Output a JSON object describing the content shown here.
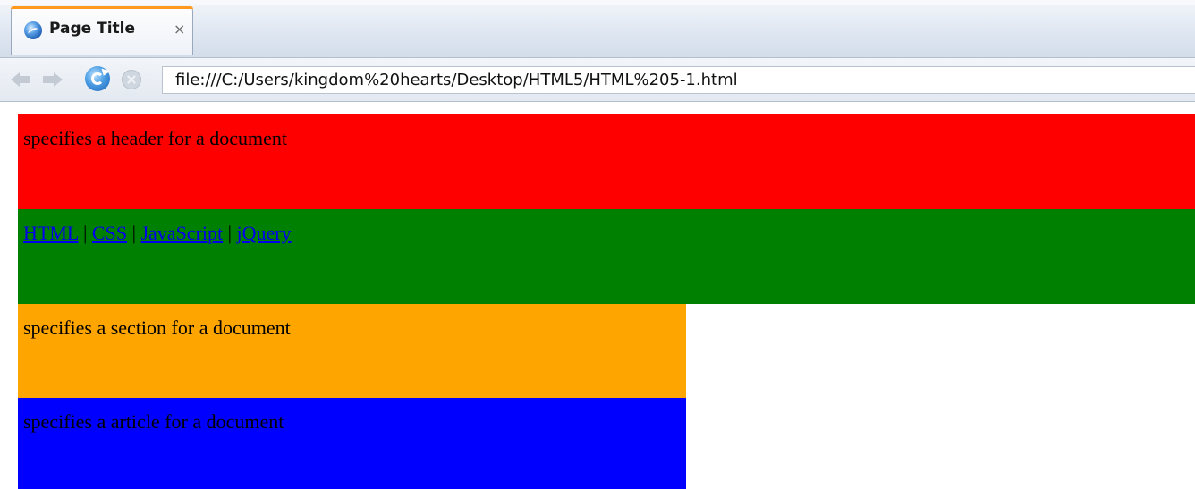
{
  "browser": {
    "tab": {
      "title": "Page Title",
      "close": "×"
    },
    "address": {
      "url": "file:///C:/Users/kingdom%20hearts/Desktop/HTML5/HTML%205-1.html"
    }
  },
  "page": {
    "header": {
      "text": "specifies a header for a document",
      "color": "#ff0000"
    },
    "nav": {
      "links": [
        "HTML",
        "CSS",
        "JavaScript",
        "jQuery"
      ],
      "separator": " | ",
      "color": "#008000"
    },
    "section": {
      "text": "specifies a section for a document",
      "color": "#ffa500"
    },
    "article": {
      "text": "specifies a article for a document",
      "color": "#0000ff"
    }
  }
}
